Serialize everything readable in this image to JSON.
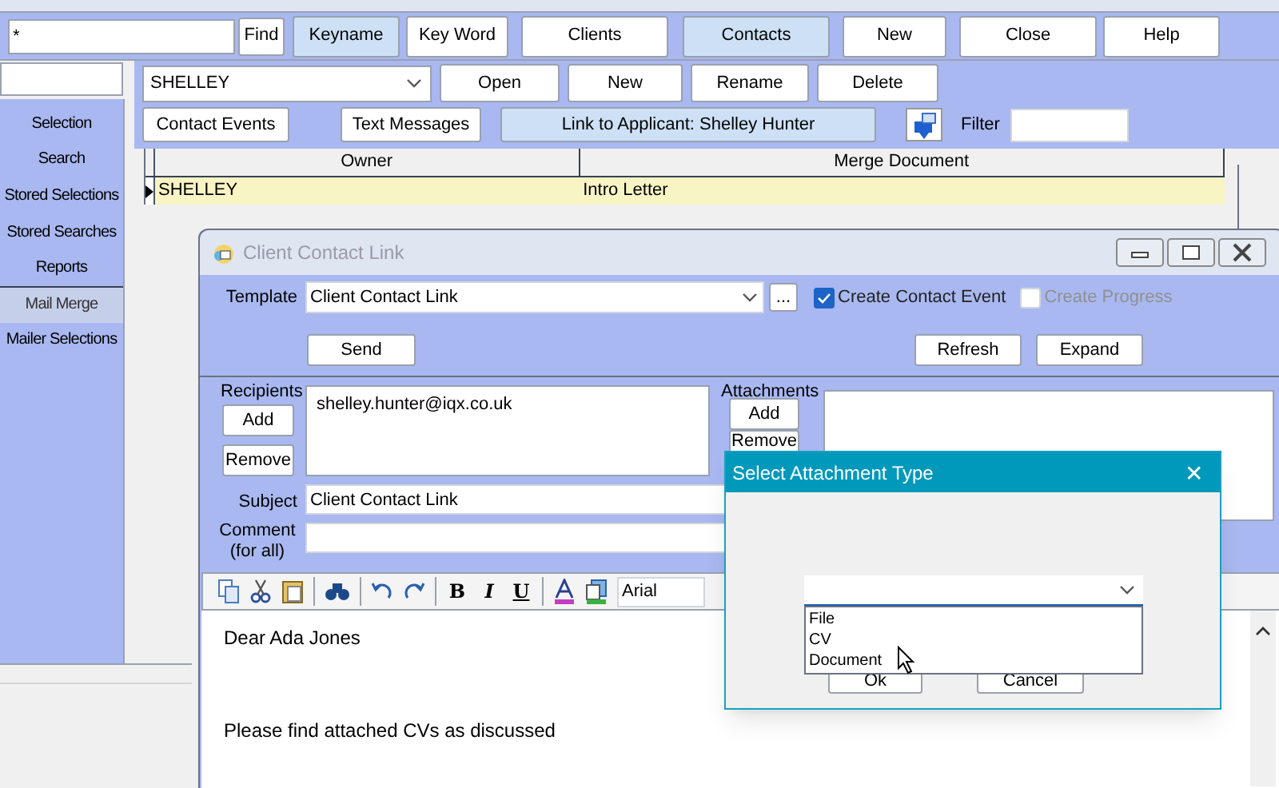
{
  "toolbar": {
    "search_value": "*",
    "find": "Find",
    "buttons": [
      {
        "label": "Keyname",
        "selected": true
      },
      {
        "label": "Key Word",
        "selected": false
      },
      {
        "label": "Clients",
        "selected": false
      },
      {
        "label": "Contacts",
        "selected": true
      },
      {
        "label": "New",
        "selected": false
      },
      {
        "label": "Close",
        "selected": false
      },
      {
        "label": "Help",
        "selected": false
      }
    ]
  },
  "sidebar": {
    "items": [
      {
        "label": "Selection",
        "selected": false
      },
      {
        "label": "Search",
        "selected": false
      },
      {
        "label": "Stored Selections",
        "selected": false
      },
      {
        "label": "Stored Searches",
        "selected": false
      },
      {
        "label": "Reports",
        "selected": false
      },
      {
        "label": "Mail Merge",
        "selected": true
      },
      {
        "label": "Mailer Selections",
        "selected": false
      }
    ]
  },
  "contact_panel": {
    "contact": "SHELLEY",
    "actions": [
      "Open",
      "New",
      "Rename",
      "Delete"
    ],
    "buttons": [
      "Contact Events",
      "Text Messages"
    ],
    "link": "Link to Applicant: Shelley Hunter",
    "filter_label": "Filter"
  },
  "grid": {
    "columns": [
      "Owner",
      "Merge Document"
    ],
    "rows": [
      {
        "cells": [
          "SHELLEY",
          "Intro Letter"
        ],
        "selected": true
      }
    ]
  },
  "window": {
    "title": "Client Contact Link",
    "template_label": "Template",
    "template": "Client Contact Link",
    "browse": "...",
    "options": [
      {
        "label": "Create Contact Event",
        "checked": true,
        "disabled": false
      },
      {
        "label": "Create Progress",
        "checked": false,
        "disabled": true
      }
    ],
    "send": "Send",
    "refresh": "Refresh",
    "expand": "Expand",
    "recipients_label": "Recipients",
    "recipients_add": "Add",
    "recipients_remove": "Remove",
    "recipients": [
      "shelley.hunter@iqx.co.uk"
    ],
    "attachments_label": "Attachments",
    "attachments_add": "Add",
    "attachments_remove": "Remove",
    "subject_label": "Subject",
    "subject": "Client Contact Link",
    "comment_label": [
      "Comment",
      "(for all)"
    ],
    "format_buttons": [
      "B",
      "I",
      "U"
    ],
    "font": "Arial",
    "body": [
      "Dear Ada Jones",
      "Please find attached CVs as discussed"
    ]
  },
  "dialog": {
    "title": "Select Attachment Type",
    "close": "✕",
    "options": [
      {
        "label": "File",
        "selected": false
      },
      {
        "label": "CV",
        "selected": false
      },
      {
        "label": "Document",
        "selected": false
      }
    ],
    "ok": "Ok",
    "cancel": "Cancel"
  }
}
